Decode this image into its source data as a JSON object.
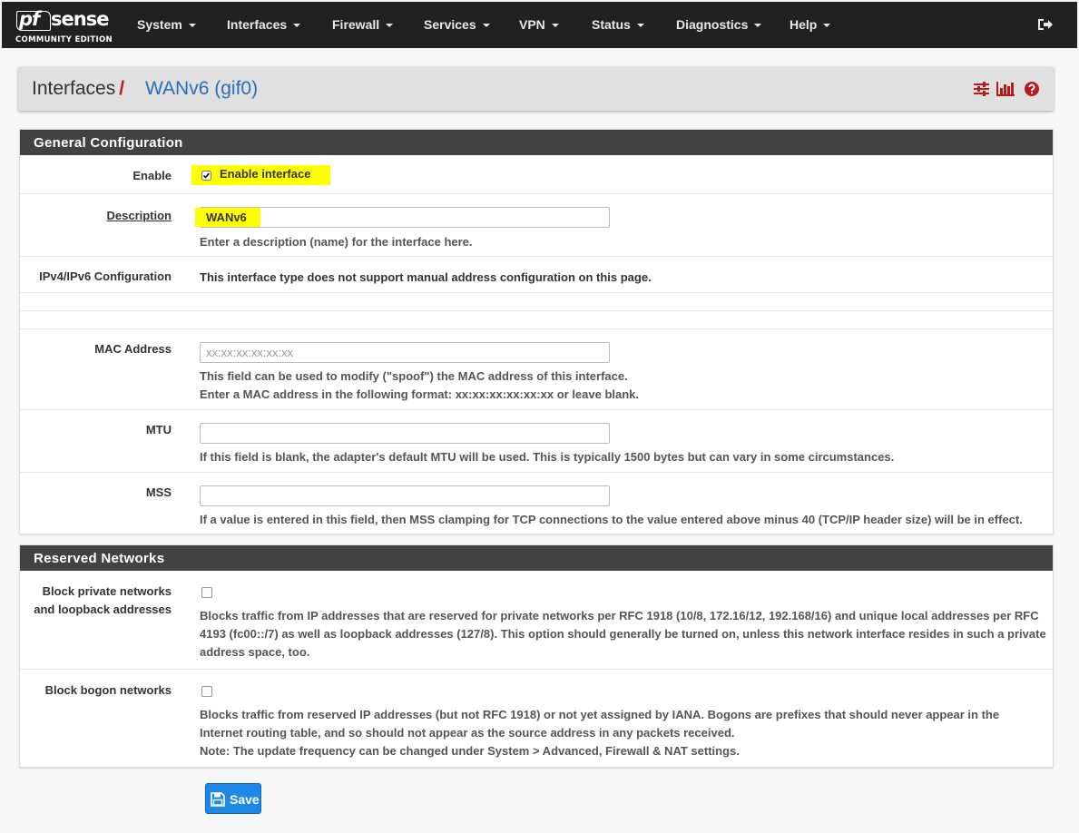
{
  "navbar": {
    "logo_pf": "pf",
    "logo_sense": "sense",
    "logo_edition": "COMMUNITY EDITION",
    "menu": [
      "System",
      "Interfaces",
      "Firewall",
      "Services",
      "VPN",
      "Status",
      "Diagnostics",
      "Help"
    ]
  },
  "breadcrumb": {
    "section": "Interfaces",
    "separator": "/",
    "current": "WANv6 (gif0)"
  },
  "general": {
    "heading": "General Configuration",
    "enable_label": "Enable",
    "enable_checkbox_label": "Enable interface",
    "enable_checked": true,
    "description_label": "Description",
    "description_value": "WANv6",
    "description_help": "Enter a description (name) for the interface here.",
    "ipconfig_label": "IPv4/IPv6 Configuration",
    "ipconfig_text": "This interface type does not support manual address configuration on this page.",
    "mac_label": "MAC Address",
    "mac_placeholder": "xx:xx:xx:xx:xx:xx",
    "mac_help_1": "This field can be used to modify (\"spoof\") the MAC address of this interface.",
    "mac_help_2": "Enter a MAC address in the following format: xx:xx:xx:xx:xx:xx or leave blank.",
    "mtu_label": "MTU",
    "mtu_help": "If this field is blank, the adapter's default MTU will be used. This is typically 1500 bytes but can vary in some circumstances.",
    "mss_label": "MSS",
    "mss_help": "If a value is entered in this field, then MSS clamping for TCP connections to the value entered above minus 40 (TCP/IP header size) will be in effect."
  },
  "reserved": {
    "heading": "Reserved Networks",
    "private_label_1": "Block private networks",
    "private_label_2": "and loopback addresses",
    "private_help": "Blocks traffic from IP addresses that are reserved for private networks per RFC 1918 (10/8, 172.16/12, 192.168/16) and unique local addresses per RFC 4193 (fc00::/7) as well as loopback addresses (127/8). This option should generally be turned on, unless this network interface resides in such a private address space, too.",
    "bogon_label": "Block bogon networks",
    "bogon_help_1": "Blocks traffic from reserved IP addresses (but not RFC 1918) or not yet assigned by IANA. Bogons are prefixes that should never appear in the Internet routing table, and so should not appear as the source address in any packets received.",
    "bogon_help_2": "Note: The update frequency can be changed under System > Advanced, Firewall & NAT settings."
  },
  "save_label": "Save",
  "colors": {
    "navbar": "#212121",
    "panel_heading": "#424242",
    "link_blue": "#2a6db8",
    "accent_red": "#b71c1c",
    "save_blue": "#1e88e5",
    "highlight": "#ffff00"
  }
}
